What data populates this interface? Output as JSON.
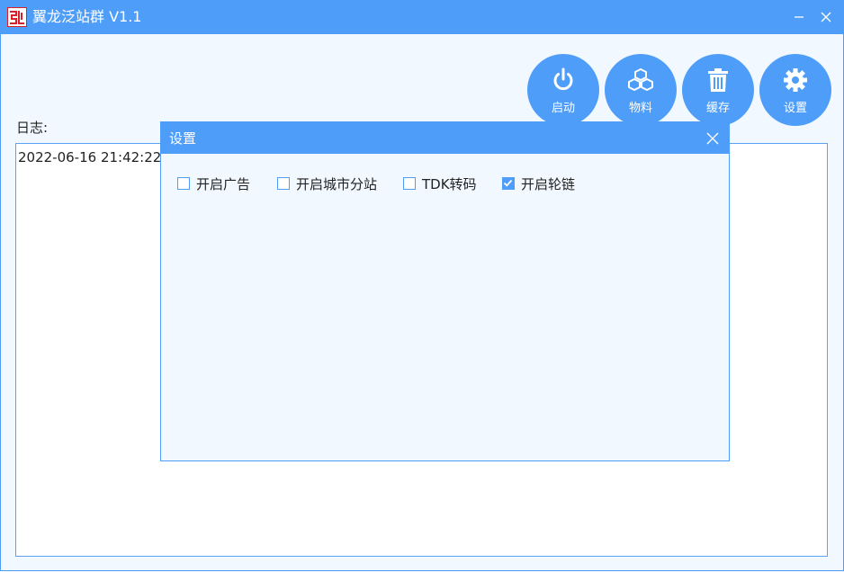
{
  "window": {
    "title": "翼龙泛站群 V1.1",
    "accent": "#4e9df8",
    "logo_color": "#d8202a"
  },
  "toolbar": {
    "buttons": [
      {
        "label": "启动",
        "icon": "power-icon"
      },
      {
        "label": "物料",
        "icon": "cubes-icon"
      },
      {
        "label": "缓存",
        "icon": "trash-icon"
      },
      {
        "label": "设置",
        "icon": "gear-icon"
      }
    ]
  },
  "log": {
    "label": "日志:",
    "lines": [
      "2022-06-16 21:42:22:"
    ]
  },
  "settings_dialog": {
    "title": "设置",
    "options": [
      {
        "label": "开启广告",
        "checked": false
      },
      {
        "label": "开启城市分站",
        "checked": false
      },
      {
        "label": "TDK转码",
        "checked": false
      },
      {
        "label": "开启轮链",
        "checked": true
      }
    ]
  }
}
